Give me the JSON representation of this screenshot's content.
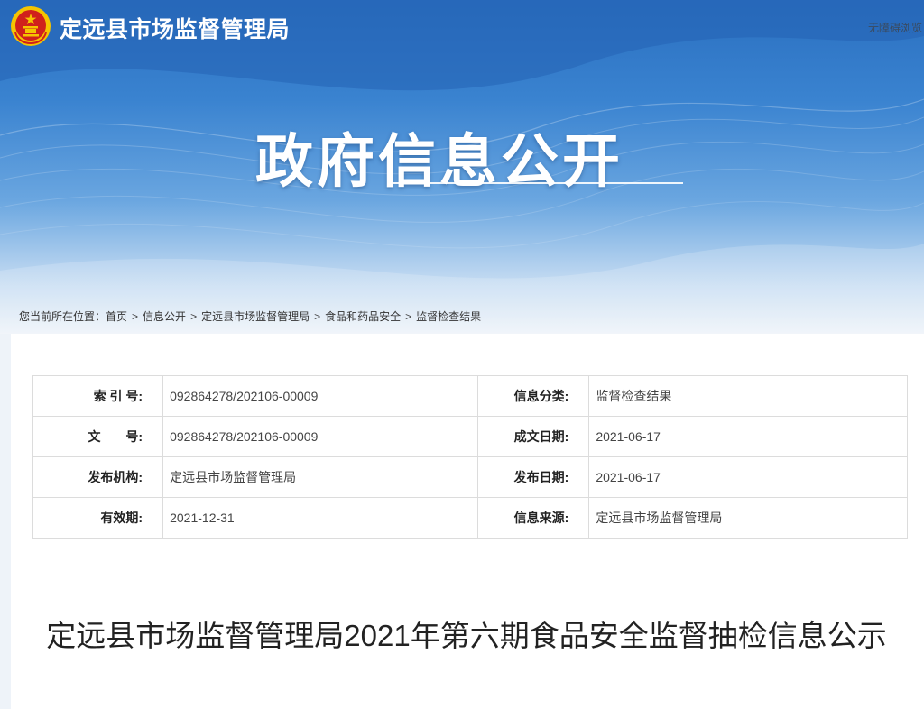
{
  "header": {
    "site_title": "定远县市场监督管理局",
    "accessibility_link": "无障碍浏览",
    "banner_heading": "政府信息公开"
  },
  "breadcrumb": {
    "prefix": "您当前所在位置：",
    "items": [
      "首页",
      "信息公开",
      "定远县市场监督管理局",
      "食品和药品安全",
      "监督检查结果"
    ],
    "separator": ">"
  },
  "meta_table": {
    "rows": [
      {
        "label1": "索 引 号:",
        "value1": "092864278/202106-00009",
        "label2": "信息分类:",
        "value2": "监督检查结果"
      },
      {
        "label1": "文　　号:",
        "value1": "092864278/202106-00009",
        "label2": "成文日期:",
        "value2": "2021-06-17"
      },
      {
        "label1": "发布机构:",
        "value1": "定远县市场监督管理局",
        "label2": "发布日期:",
        "value2": "2021-06-17"
      },
      {
        "label1": "有效期:",
        "value1": "2021-12-31",
        "label2": "信息来源:",
        "value2": "定远县市场监督管理局"
      }
    ]
  },
  "article": {
    "title": "定远县市场监督管理局2021年第六期食品安全监督抽检信息公示"
  },
  "colors": {
    "banner_blue": "#2a6fc0",
    "emblem_red": "#d0201c",
    "emblem_gold": "#f5c400"
  }
}
